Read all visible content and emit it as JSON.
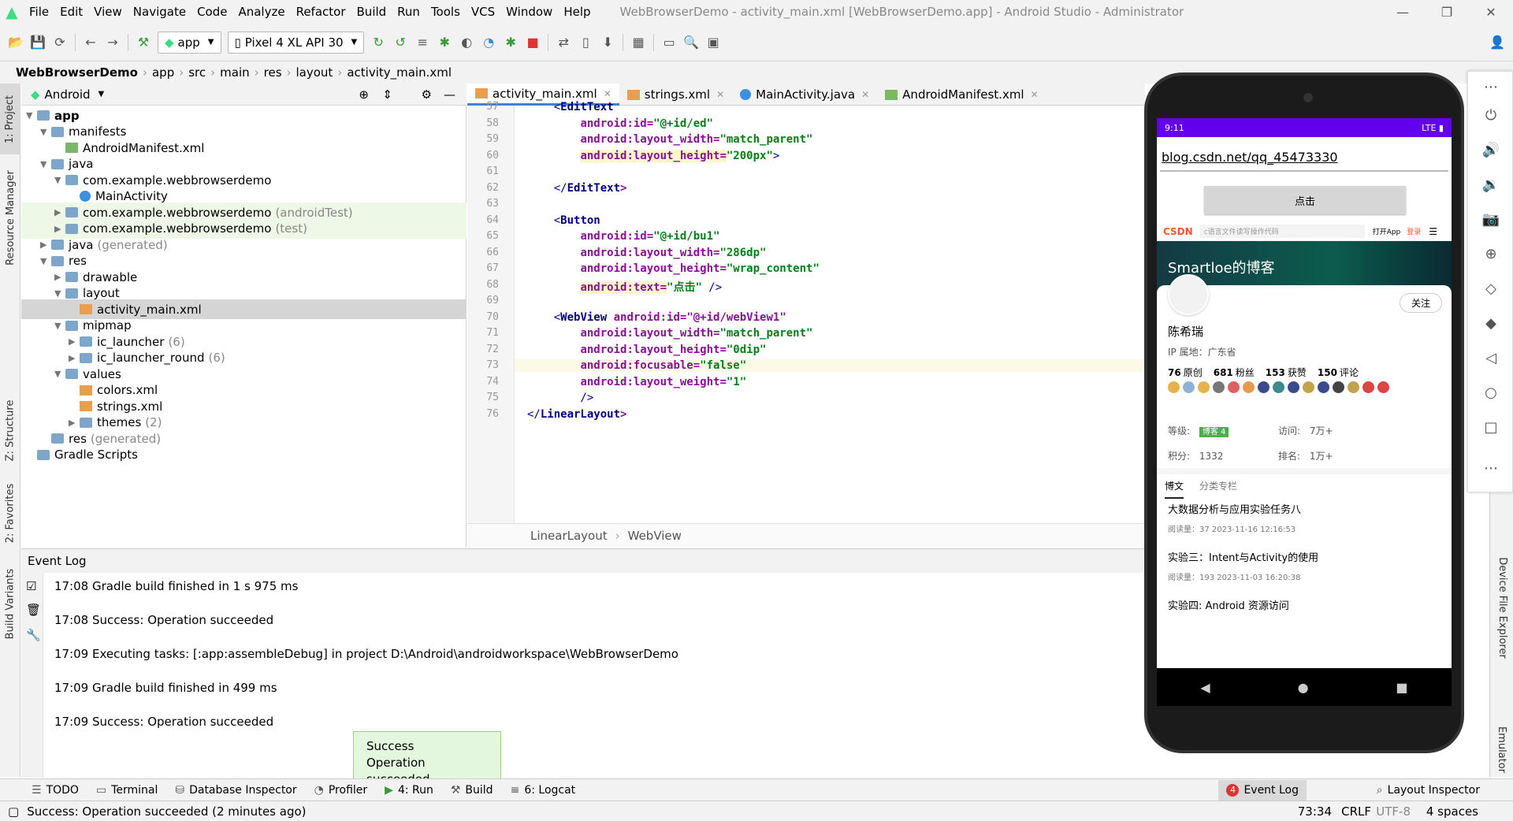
{
  "window": {
    "title": "WebBrowserDemo - activity_main.xml [WebBrowserDemo.app] - Android Studio - Administrator",
    "menu": [
      "File",
      "Edit",
      "View",
      "Navigate",
      "Code",
      "Analyze",
      "Refactor",
      "Build",
      "Run",
      "Tools",
      "VCS",
      "Window",
      "Help"
    ]
  },
  "toolbar": {
    "config": "app",
    "device": "Pixel 4 XL API 30"
  },
  "breadcrumb": [
    "WebBrowserDemo",
    "app",
    "src",
    "main",
    "res",
    "layout",
    "activity_main.xml"
  ],
  "project": {
    "view": "Android",
    "tree": [
      {
        "label": "app",
        "bold": true
      },
      {
        "label": "manifests"
      },
      {
        "label": "AndroidManifest.xml"
      },
      {
        "label": "java"
      },
      {
        "label": "com.example.webbrowserdemo"
      },
      {
        "label": "MainActivity"
      },
      {
        "label": "com.example.webbrowserdemo",
        "suffix": "(androidTest)"
      },
      {
        "label": "com.example.webbrowserdemo",
        "suffix": "(test)"
      },
      {
        "label": "java",
        "suffix": "(generated)"
      },
      {
        "label": "res"
      },
      {
        "label": "drawable"
      },
      {
        "label": "layout"
      },
      {
        "label": "activity_main.xml"
      },
      {
        "label": "mipmap"
      },
      {
        "label": "ic_launcher",
        "suffix": "(6)"
      },
      {
        "label": "ic_launcher_round",
        "suffix": "(6)"
      },
      {
        "label": "values"
      },
      {
        "label": "colors.xml"
      },
      {
        "label": "strings.xml"
      },
      {
        "label": "themes",
        "suffix": "(2)"
      },
      {
        "label": "res",
        "suffix": "(generated)"
      },
      {
        "label": "Gradle Scripts"
      }
    ]
  },
  "tabs": [
    "activity_main.xml",
    "strings.xml",
    "MainActivity.java",
    "AndroidManifest.xml"
  ],
  "code": {
    "lines": [
      {
        "n": "57",
        "pre": "    <",
        "tag": "EditText",
        "rest": ""
      },
      {
        "n": "58",
        "attr": "android:id=",
        "val": "\"@+id/ed\"",
        "post": ""
      },
      {
        "n": "59",
        "attr": "android:layout_width=",
        "val": "\"match_parent\"",
        "post": ""
      },
      {
        "n": "60",
        "attr": "android:layout_height=",
        "val": "\"200px\"",
        "post": ">"
      },
      {
        "n": "61",
        "pre": "",
        "tag": "",
        "rest": ""
      },
      {
        "n": "62",
        "pre": "    </",
        "tag": "EditText",
        "rest": ">"
      },
      {
        "n": "63",
        "pre": "",
        "tag": "",
        "rest": ""
      },
      {
        "n": "64",
        "pre": "    <",
        "tag": "Button",
        "rest": ""
      },
      {
        "n": "65",
        "attr": "android:id=",
        "val": "\"@+id/bu1\"",
        "post": ""
      },
      {
        "n": "66",
        "attr": "android:layout_width=",
        "val": "\"286dp\"",
        "post": ""
      },
      {
        "n": "67",
        "attr": "android:layout_height=",
        "val": "\"wrap_content\"",
        "post": ""
      },
      {
        "n": "68",
        "attr": "android:text=",
        "val": "\"点击\"",
        "post": " />"
      },
      {
        "n": "69",
        "pre": "",
        "tag": "",
        "rest": ""
      },
      {
        "n": "70",
        "pre": "    <",
        "tag": "WebView",
        "rest": " android:id=\"@+id/webView1\""
      },
      {
        "n": "71",
        "attr": "android:layout_width=",
        "val": "\"match_parent\"",
        "post": ""
      },
      {
        "n": "72",
        "attr": "android:layout_height=",
        "val": "\"0dip\"",
        "post": ""
      },
      {
        "n": "73",
        "attr": "android:focusable=",
        "val": "\"false\"",
        "post": ""
      },
      {
        "n": "74",
        "attr": "android:layout_weight=",
        "val": "\"1\"",
        "post": ""
      },
      {
        "n": "75",
        "pre": "        />",
        "tag": "",
        "rest": ""
      },
      {
        "n": "76",
        "pre": "</",
        "tag": "LinearLayout",
        "rest": ">"
      }
    ],
    "path": [
      "LinearLayout",
      "WebView"
    ]
  },
  "eventlog": {
    "title": "Event Log",
    "entries": [
      "17:08  Gradle build finished in 1 s 975 ms",
      "17:08  Success: Operation succeeded",
      "17:09  Executing tasks: [:app:assembleDebug] in project D:\\Android\\androidworkspace\\WebBrowserDemo",
      "17:09  Gradle build finished in 499 ms",
      "17:09  Success: Operation succeeded"
    ]
  },
  "toast": {
    "line1": "Success",
    "line2": "Operation succeeded"
  },
  "bottom_tabs": [
    "TODO",
    "Terminal",
    "Database Inspector",
    "Profiler",
    "4: Run",
    "Build",
    "6: Logcat"
  ],
  "bottom_right_tabs": [
    "Event Log",
    "Layout Inspector"
  ],
  "event_count": "4",
  "status": {
    "message": "Success: Operation succeeded (2 minutes ago)",
    "pos": "73:34",
    "crlf": "CRLF",
    "enc": "UTF-8",
    "indent": "4 spaces"
  },
  "side_tabs_left": [
    "1: Project",
    "Resource Manager",
    "Z: Structure",
    "2: Favorites",
    "Build Variants"
  ],
  "side_tabs_right": [
    "Device File Explorer",
    "Emulator"
  ],
  "phone": {
    "time": "9:11",
    "network": "LTE",
    "url": "blog.csdn.net/qq_45473330",
    "button": "点击",
    "csdn_logo": "CSDN",
    "search_hint": "c语言文件读写操作代码",
    "open_app": "打开App",
    "login": "登录",
    "banner_title": "Smartloe的博客",
    "follow": "关注",
    "name": "陈希瑞",
    "ip": "IP 属地：广东省",
    "stats": [
      {
        "v": "76",
        "l": "原创"
      },
      {
        "v": "681",
        "l": "粉丝"
      },
      {
        "v": "153",
        "l": "获赞"
      },
      {
        "v": "150",
        "l": "评论"
      }
    ],
    "level_label": "等级:",
    "level_badge": "博客 4",
    "visits_label": "访问:",
    "visits": "7万+",
    "points_label": "积分:",
    "points": "1332",
    "rank_label": "排名:",
    "rank": "1万+",
    "tabs": [
      "博文",
      "分类专栏"
    ],
    "posts": [
      {
        "title": "大数据分析与应用实验任务八",
        "meta": "阅读量：37     2023-11-16 12:16:53"
      },
      {
        "title": "实验三：Intent与Activity的使用",
        "meta": "阅读量：193     2023-11-03 16:20:38"
      },
      {
        "title": "实验四: Android 资源访问",
        "meta": ""
      }
    ]
  }
}
